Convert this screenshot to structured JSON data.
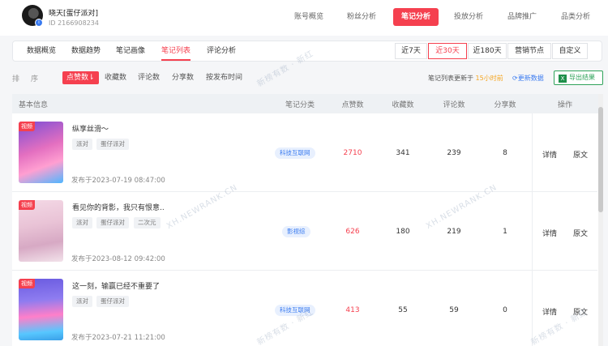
{
  "account": {
    "name": "晓天[蛋仔派对]",
    "id_text": "ID 2166908234",
    "badge_icon": "verified-icon"
  },
  "top_nav": [
    "账号概览",
    "粉丝分析",
    "笔记分析",
    "投放分析",
    "品牌推广",
    "品类分析"
  ],
  "sub_tabs": [
    "数据概览",
    "数据趋势",
    "笔记画像",
    "笔记列表",
    "评论分析"
  ],
  "ranges": [
    "近7天",
    "近30天",
    "近180天",
    "营销节点",
    "自定义"
  ],
  "sort": {
    "label": "排序",
    "options": [
      "点赞数⇂",
      "收藏数",
      "评论数",
      "分享数",
      "按发布时间"
    ],
    "update_prefix": "笔记列表更新于",
    "update_highlight": "15小时前",
    "refresh_label": "更新数据",
    "export_label": "导出结果"
  },
  "table": {
    "headers": [
      "基本信息",
      "笔记分类",
      "点赞数",
      "收藏数",
      "评论数",
      "分享数",
      "操作"
    ],
    "rows": [
      {
        "tag": "视频",
        "title": "纵享丝滑～",
        "tags": [
          "派对",
          "蛋仔派对"
        ],
        "published": "发布于2023-07-19 08:47:00",
        "category": "科技互联网",
        "likes": "2710",
        "collects": "341",
        "comments": "239",
        "shares": "8",
        "detail": "详情",
        "original": "原文"
      },
      {
        "tag": "视频",
        "title": "看见你的背影，我只有恨意..",
        "tags": [
          "派对",
          "蛋仔派对",
          "二次元"
        ],
        "published": "发布于2023-08-12 09:42:00",
        "category": "影视综",
        "likes": "626",
        "collects": "180",
        "comments": "219",
        "shares": "1",
        "detail": "详情",
        "original": "原文"
      },
      {
        "tag": "视频",
        "title": "这一刻，输赢已经不重要了",
        "tags": [
          "派对",
          "蛋仔派对"
        ],
        "published": "发布于2023-07-21 11:21:00",
        "category": "科技互联网",
        "likes": "413",
        "collects": "55",
        "comments": "59",
        "shares": "0",
        "detail": "详情",
        "original": "原文"
      }
    ]
  },
  "watermark": {
    "cn": "新榜有数 · 新红",
    "en": "XH.NEWRANK.CN"
  },
  "colors": {
    "accent": "#f5404f",
    "link": "#3a7bf0",
    "export": "#2fa35a",
    "highlight": "#f5a623"
  }
}
